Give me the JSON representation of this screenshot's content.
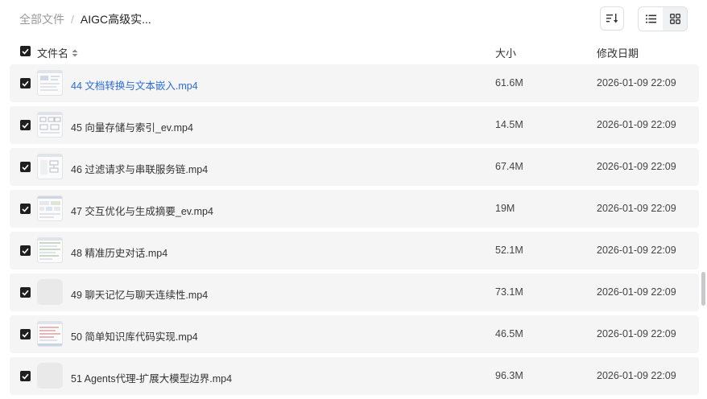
{
  "breadcrumb": {
    "root": "全部文件",
    "separator": "/",
    "current": "AIGC高级实..."
  },
  "toolbar": {
    "sort_icon": "sort-descending-icon",
    "list_view_icon": "list-view-icon",
    "grid_view_icon": "grid-view-icon"
  },
  "columns": {
    "name": "文件名",
    "size": "大小",
    "modified": "修改日期"
  },
  "rows": [
    {
      "name": "44 文档转换与文本嵌入.mp4",
      "size": "61.6M",
      "modified": "2026-01-09 22:09",
      "thumb": "screenshot",
      "highlighted": true
    },
    {
      "name": "45 向量存储与索引_ev.mp4",
      "size": "14.5M",
      "modified": "2026-01-09 22:09",
      "thumb": "screenshot"
    },
    {
      "name": "46 过滤请求与串联服务链.mp4",
      "size": "67.4M",
      "modified": "2026-01-09 22:09",
      "thumb": "screenshot"
    },
    {
      "name": "47 交互优化与生成摘要_ev.mp4",
      "size": "19M",
      "modified": "2026-01-09 22:09",
      "thumb": "screenshot"
    },
    {
      "name": "48 精准历史对话.mp4",
      "size": "52.1M",
      "modified": "2026-01-09 22:09",
      "thumb": "screenshot"
    },
    {
      "name": "49 聊天记忆与聊天连续性.mp4",
      "size": "73.1M",
      "modified": "2026-01-09 22:09",
      "thumb": "blank"
    },
    {
      "name": "50 简单知识库代码实现.mp4",
      "size": "46.5M",
      "modified": "2026-01-09 22:09",
      "thumb": "screenshot"
    },
    {
      "name": "51 Agents代理-扩展大模型边界.mp4",
      "size": "96.3M",
      "modified": "2026-01-09 22:09",
      "thumb": "blank"
    }
  ],
  "colors": {
    "link": "#2b6bd8",
    "row_bg": "#f5f5f6",
    "checkbox": "#1f1f1f"
  }
}
